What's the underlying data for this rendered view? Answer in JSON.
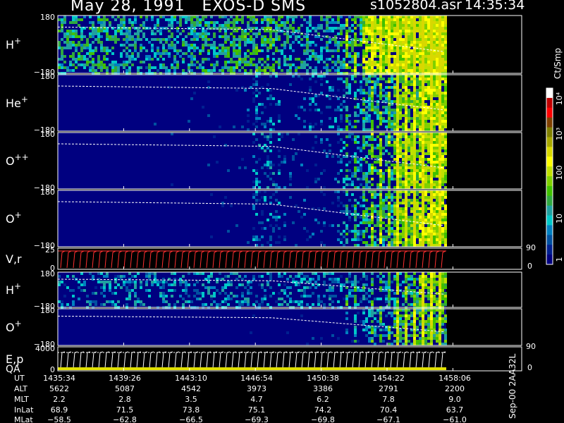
{
  "header": {
    "date": "May 28, 1991",
    "instrument": "EXOS-D SMS",
    "filename": "s1052804.asr",
    "time": "14:35:34"
  },
  "side_note": "Sep-00 2AA32L",
  "colorbar": {
    "label": "Ct/Smp",
    "ticks": [
      "10⁴",
      "10³",
      "100",
      "10",
      "1"
    ],
    "colors": [
      "#ffffff",
      "#c00000",
      "#ff0000",
      "#804000",
      "#808000",
      "#a8a800",
      "#d8d800",
      "#ffff00",
      "#c0e000",
      "#80d000",
      "#40c000",
      "#30a840",
      "#20a0a0",
      "#00c8c8",
      "#0080c0",
      "#0050a0",
      "#002090",
      "#000080"
    ]
  },
  "panels": [
    {
      "label": "H",
      "sup": "+",
      "top": "180",
      "bottom": "−180"
    },
    {
      "label": "He",
      "sup": "+",
      "top": "180",
      "bottom": "−180"
    },
    {
      "label": "O",
      "sup": "++",
      "top": "180",
      "bottom": "−180"
    },
    {
      "label": "O",
      "sup": "+",
      "top": "180",
      "bottom": "−180"
    },
    {
      "label": "V,r",
      "sup": "",
      "top": "25",
      "bottom": "0",
      "right_top": "90",
      "right_bottom": "0"
    },
    {
      "label": "H",
      "sup": "+",
      "top": "180",
      "bottom": "−180"
    },
    {
      "label": "O",
      "sup": "+",
      "top": "180",
      "bottom": "−180"
    },
    {
      "label": "E,p",
      "sup": "",
      "label2": "QA",
      "top": "4000",
      "bottom": "0",
      "right_top": "90",
      "right_bottom": "0"
    }
  ],
  "ephemeris": {
    "row_labels": [
      "UT",
      "ALT",
      "MLT",
      "InLat",
      "MLat"
    ],
    "columns": [
      {
        "UT": "1435:34",
        "ALT": "5622",
        "MLT": "2.2",
        "InLat": "68.9",
        "MLat": "−58.5"
      },
      {
        "UT": "1439:26",
        "ALT": "5087",
        "MLT": "2.8",
        "InLat": "71.5",
        "MLat": "−62.8"
      },
      {
        "UT": "1443:10",
        "ALT": "4542",
        "MLT": "3.5",
        "InLat": "73.8",
        "MLat": "−66.5"
      },
      {
        "UT": "1446:54",
        "ALT": "3973",
        "MLT": "4.7",
        "InLat": "75.1",
        "MLat": "−69.3"
      },
      {
        "UT": "1450:38",
        "ALT": "3386",
        "MLT": "6.2",
        "InLat": "74.2",
        "MLat": "−69.8"
      },
      {
        "UT": "1454:22",
        "ALT": "2791",
        "MLT": "7.8",
        "InLat": "70.4",
        "MLat": "−67.1"
      },
      {
        "UT": "1458:06",
        "ALT": "2200",
        "MLT": "9.0",
        "InLat": "63.7",
        "MLat": "−61.0"
      }
    ]
  },
  "chart_data": {
    "type": "heatmap",
    "title": "May 28, 1991   EXOS-D SMS",
    "xlabel": "UT",
    "x_ticks": [
      "1435:34",
      "1439:26",
      "1443:10",
      "1446:54",
      "1450:38",
      "1454:22",
      "1458:06"
    ],
    "colorbar_label": "Ct/Smp",
    "series": [
      {
        "name": "H+",
        "yrange": [
          -180,
          180
        ],
        "activity": [
          0.55,
          0.55,
          0.5,
          0.45,
          0.5,
          0.55,
          0.6,
          0.6,
          0.5,
          0.45,
          0.55,
          0.9,
          0.95,
          1.0
        ]
      },
      {
        "name": "He+",
        "yrange": [
          -180,
          180
        ],
        "activity": [
          0.0,
          0.0,
          0.0,
          0.02,
          0.03,
          0.03,
          0.1,
          0.25,
          0.12,
          0.2,
          0.3,
          0.5,
          0.75,
          0.9
        ]
      },
      {
        "name": "O++",
        "yrange": [
          -180,
          180
        ],
        "activity": [
          0.0,
          0.0,
          0.0,
          0.0,
          0.02,
          0.03,
          0.05,
          0.3,
          0.12,
          0.15,
          0.3,
          0.55,
          0.8,
          0.9
        ]
      },
      {
        "name": "O+",
        "yrange": [
          -180,
          180
        ],
        "activity": [
          0.0,
          0.0,
          0.0,
          0.0,
          0.0,
          0.02,
          0.03,
          0.25,
          0.1,
          0.12,
          0.3,
          0.55,
          0.8,
          0.9
        ]
      },
      {
        "name": "H+",
        "yrange": [
          -180,
          180
        ],
        "activity": [
          0.3,
          0.35,
          0.35,
          0.35,
          0.35,
          0.35,
          0.35,
          0.3,
          0.35,
          0.35,
          0.3,
          0.35,
          0.5,
          0.8
        ]
      },
      {
        "name": "O+",
        "yrange": [
          -180,
          180
        ],
        "activity": [
          0.0,
          0.0,
          0.0,
          0.0,
          0.0,
          0.0,
          0.02,
          0.03,
          0.03,
          0.05,
          0.1,
          0.35,
          0.65,
          0.7
        ]
      }
    ]
  }
}
